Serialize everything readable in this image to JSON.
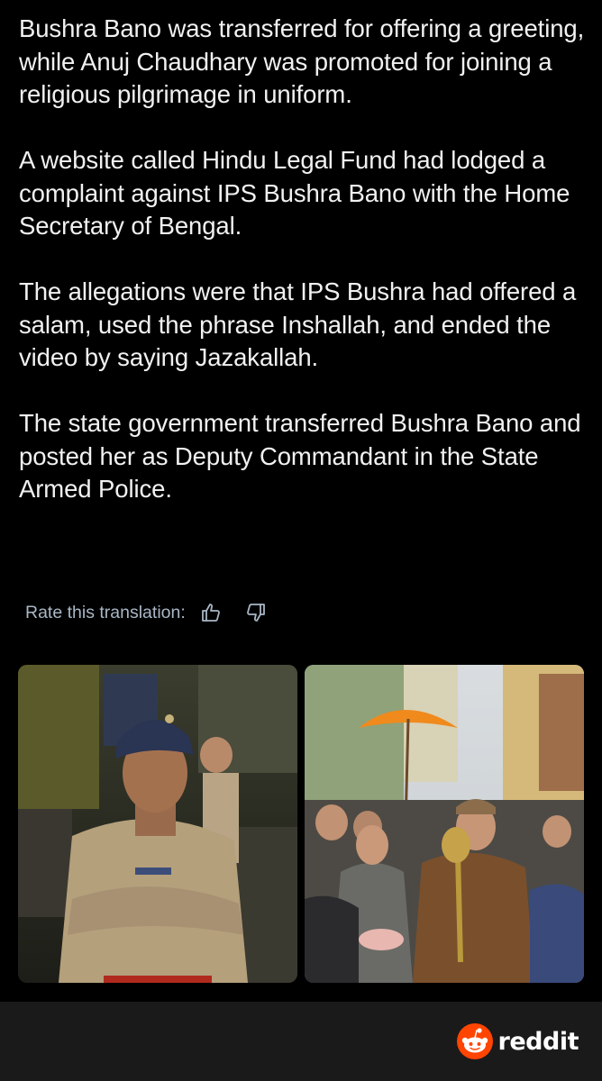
{
  "post": {
    "paragraphs": [
      "Bushra Bano was transferred for offering a greeting, while Anuj Chaudhary was promoted for joining a religious pilgrimage in uniform.",
      "A website called Hindu Legal Fund had lodged a complaint against IPS Bushra Bano with the Home Secretary of Bengal.",
      "The allegations were that IPS Bushra had offered a salam, used the phrase Inshallah, and ended the video by saying Jazakallah.",
      "The state government transferred Bushra Bano and posted her as Deputy Commandant in the State Armed Police."
    ]
  },
  "translation": {
    "rate_label": "Rate this translation:",
    "thumbs_up_icon": "thumbs-up-icon",
    "thumbs_down_icon": "thumbs-down-icon"
  },
  "media": {
    "left_image": "photo of a policewoman in khaki uniform with a navy beret, arms crossed",
    "right_image": "photo of a uniformed officer carrying a golden mace in a street procession under an orange umbrella"
  },
  "footer": {
    "brand_name": "reddit",
    "brand_icon": "reddit-snoo-icon",
    "brand_color": "#ff4500"
  },
  "colors": {
    "background": "#000000",
    "text": "#f1f1f1",
    "muted_text": "#a9b7c6",
    "footer_bg": "#1a1a1b"
  }
}
